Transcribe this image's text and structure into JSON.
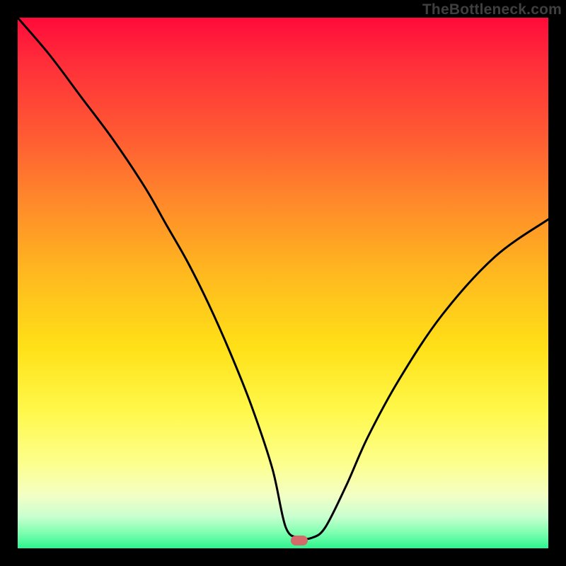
{
  "site_label": "TheBottleneck.com",
  "marker": {
    "x_frac": 0.53,
    "y_frac": 0.985
  },
  "chart_data": {
    "type": "line",
    "title": "",
    "xlabel": "",
    "ylabel": "",
    "xlim": [
      0,
      1
    ],
    "ylim": [
      0,
      1
    ],
    "series": [
      {
        "name": "curve",
        "x": [
          0.0,
          0.06,
          0.12,
          0.18,
          0.24,
          0.28,
          0.32,
          0.36,
          0.4,
          0.44,
          0.48,
          0.505,
          0.53,
          0.555,
          0.58,
          0.62,
          0.66,
          0.72,
          0.8,
          0.9,
          1.0
        ],
        "y": [
          1.0,
          0.93,
          0.85,
          0.77,
          0.68,
          0.61,
          0.54,
          0.46,
          0.37,
          0.27,
          0.15,
          0.04,
          0.02,
          0.02,
          0.04,
          0.12,
          0.21,
          0.32,
          0.44,
          0.55,
          0.62
        ]
      }
    ],
    "annotations": []
  },
  "colors": {
    "curve": "#000000",
    "marker": "#d46a6a",
    "frame": "#000000"
  }
}
